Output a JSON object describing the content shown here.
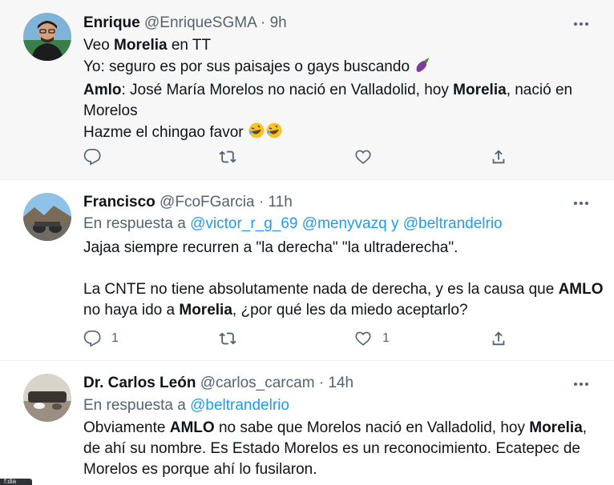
{
  "tweets": [
    {
      "name": "Enrique",
      "handle": "@EnriqueSGMA",
      "dot": "·",
      "time": "9h",
      "lines": [
        [
          "Veo ",
          "Morelia",
          " en TT"
        ],
        [
          "Yo: seguro es por sus paisajes o gays buscando"
        ],
        [
          "Amlo",
          ": José María Morelos no nació en Valladolid, hoy ",
          "Morelia",
          ", nació en"
        ],
        [
          "Morelos"
        ],
        [
          "Hazme el chingao favor"
        ]
      ],
      "emoji_eggplant": "eggplant-emoji",
      "emoji_laugh": "rolling-laughing-emoji"
    },
    {
      "name": "Francisco",
      "handle": "@FcoFGarcia",
      "dot": "·",
      "time": "11h",
      "reply_prefix": "En respuesta a",
      "mention1": "@victor_r_g_69",
      "mention2": "@menyvazq",
      "reply_and": "y",
      "mention3": "@beltrandelrio",
      "lines": [
        [
          "Jajaa siempre recurren a \"la derecha\" \"la ultraderecha\"."
        ],
        [
          ""
        ],
        [
          "La CNTE no tiene absolutamente nada de derecha, y es la causa que ",
          "AMLO"
        ],
        [
          "no haya ido a ",
          "Morelia",
          ", ¿por qué les da miedo aceptarlo?"
        ]
      ],
      "reply_count": "1",
      "like_count": "1"
    },
    {
      "name": "Dr. Carlos León",
      "handle": "@carlos_carcam",
      "dot": "·",
      "time": "14h",
      "reply_prefix": "En respuesta a",
      "mention1": "@beltrandelrio",
      "lines": [
        [
          "Obviamente ",
          "AMLO",
          " no sabe que Morelos nació en Valladolid, hoy ",
          "Morelia",
          ","
        ],
        [
          "de ahí su nombre. Es Estado Morelos es un reconocimiento. Ecatepec de"
        ],
        [
          "Morelos es porque ahí lo fusilaron."
        ]
      ]
    }
  ],
  "popup_text": "f:dia",
  "colors": {
    "accent": "#1d9bf0",
    "secondary_text": "#536471",
    "highlight_bg": "#f7f7f7"
  },
  "icons": [
    "reply-icon",
    "retweet-icon",
    "like-icon",
    "share-icon",
    "more-icon"
  ]
}
